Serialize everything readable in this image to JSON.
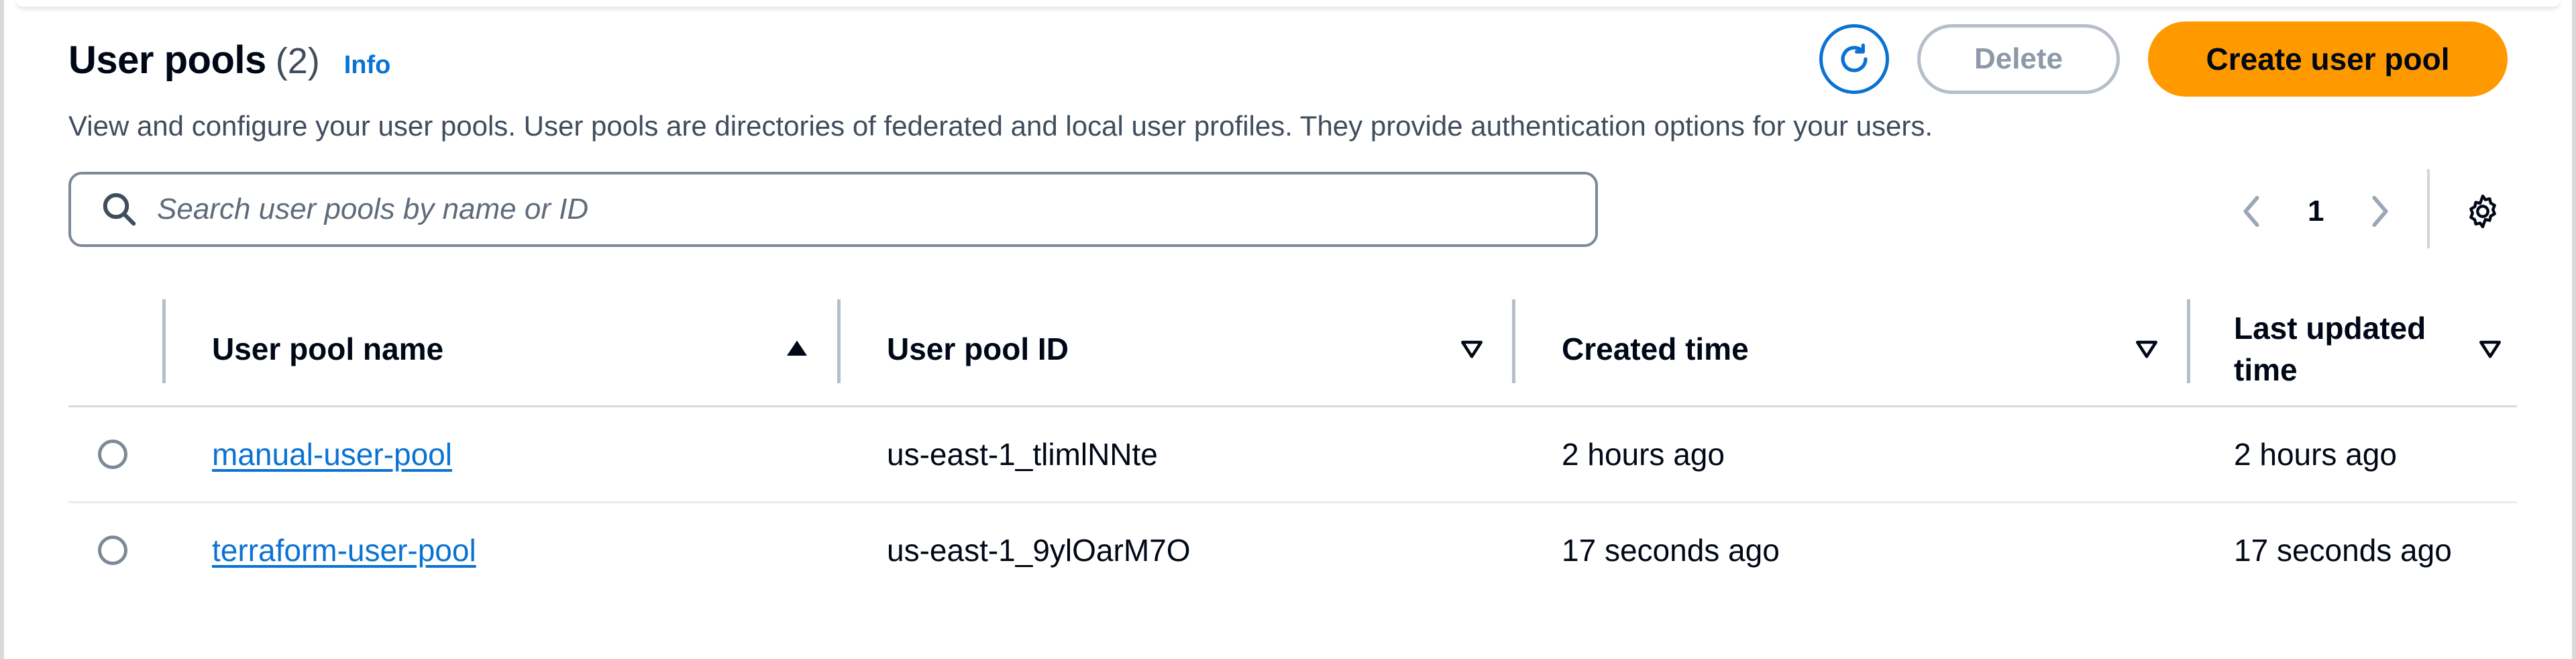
{
  "header": {
    "title": "User pools",
    "count": "(2)",
    "info_link": "Info",
    "description": "View and configure your user pools. User pools are directories of federated and local user profiles. They provide authentication options for your users."
  },
  "actions": {
    "refresh_icon": "refresh-icon",
    "delete_label": "Delete",
    "create_label": "Create user pool"
  },
  "search": {
    "placeholder": "Search user pools by name or ID",
    "value": ""
  },
  "pagination": {
    "current_page": "1",
    "prev_icon": "chevron-left-icon",
    "next_icon": "chevron-right-icon",
    "settings_icon": "gear-icon"
  },
  "table": {
    "columns": [
      {
        "label": "User pool name",
        "sort": "ascending"
      },
      {
        "label": "User pool ID",
        "sort": "none"
      },
      {
        "label": "Created time",
        "sort": "none"
      },
      {
        "label": "Last updated time",
        "sort": "none"
      }
    ],
    "rows": [
      {
        "name": "manual-user-pool",
        "id": "us-east-1_tlimlNNte",
        "created": "2 hours ago",
        "updated": "2 hours ago"
      },
      {
        "name": "terraform-user-pool",
        "id": "us-east-1_9ylOarM7O",
        "created": "17 seconds ago",
        "updated": "17 seconds ago"
      }
    ]
  },
  "colors": {
    "link": "#0972d3",
    "primary_button": "#ff9900",
    "disabled_text": "#8d99a8"
  }
}
